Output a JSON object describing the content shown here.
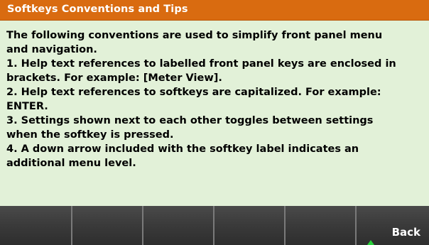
{
  "title": "Softkeys Conventions and Tips",
  "body_lines": [
    "The following conventions are used to simplify front panel menu",
    "and navigation.",
    "1. Help text references to labelled front panel keys are enclosed in",
    "brackets. For example: [Meter View].",
    "2. Help text references to softkeys are capitalized. For example:",
    "ENTER.",
    "3. Settings shown next to each other toggles between settings",
    "when the softkey is pressed.",
    "4. A down arrow included with the softkey label indicates an",
    "additional menu level."
  ],
  "softkeys": [
    "",
    "",
    "",
    "",
    "",
    "Back"
  ],
  "colors": {
    "title_bar": "#d96b10",
    "content_bg": "#e2f1d8",
    "softkey_bg": "#3a3a3a",
    "indicator": "#28d13a"
  },
  "icons": {
    "back_indicator": "up-arrow-icon"
  }
}
